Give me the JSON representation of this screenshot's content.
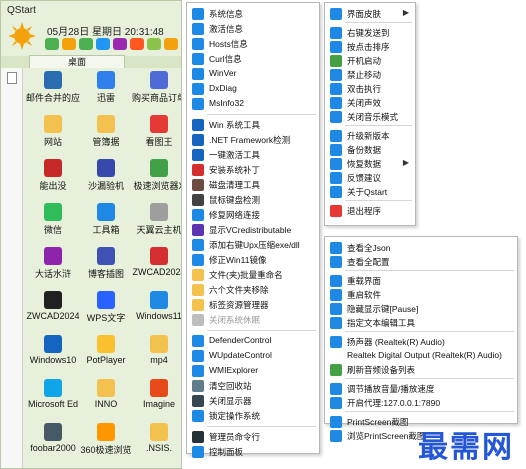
{
  "app": {
    "title": "QStart",
    "date_text": "05月28日 星期日 20:31:48",
    "desktop_tab": "桌面"
  },
  "colors": {
    "window_bg": "#e6f0da",
    "tab_bg": "#d8e6c6",
    "sun": "#f4a20c"
  },
  "week_icon_colors": [
    "#4caf50",
    "#f4a20c",
    "#4caf50",
    "#2196f3",
    "#9c27b0",
    "#ff5722",
    "#8bc34a",
    "#f4a20c"
  ],
  "desktop_items": [
    {
      "label": "邮件合并的应",
      "icon": "mail-merge-icon",
      "color": "#2b6cb0"
    },
    {
      "label": "迅雷",
      "icon": "thunder-icon",
      "color": "#2f80ed"
    },
    {
      "label": "购买商品订单",
      "icon": "order-doc-icon",
      "color": "#4f6bd6"
    },
    {
      "label": "网站",
      "icon": "folder-icon",
      "color": "#f2c14e"
    },
    {
      "label": "管簿据",
      "icon": "folder-icon",
      "color": "#f2c14e"
    },
    {
      "label": "看图王",
      "icon": "image-viewer-icon",
      "color": "#e53935"
    },
    {
      "label": "能出没",
      "icon": "file-icon",
      "color": "#c62828"
    },
    {
      "label": "沙漏验机",
      "icon": "hourglass-icon",
      "color": "#3949ab"
    },
    {
      "label": "极速浏览器X",
      "icon": "browser-icon",
      "color": "#43a047"
    },
    {
      "label": "微信",
      "icon": "wechat-icon",
      "color": "#2ebd59"
    },
    {
      "label": "工具箱",
      "icon": "toolbox-icon",
      "color": "#1e88e5"
    },
    {
      "label": "天翼云主机",
      "icon": "doc-icon",
      "color": "#9e9e9e"
    },
    {
      "label": "大话水浒",
      "icon": "game-icon",
      "color": "#8e24aa"
    },
    {
      "label": "博客插图",
      "icon": "picture-icon",
      "color": "#3f51b5"
    },
    {
      "label": "ZWCAD2024",
      "icon": "cad-icon",
      "color": "#d32f2f"
    },
    {
      "label": "ZWCAD2024",
      "icon": "cad-dark-icon",
      "color": "#212121"
    },
    {
      "label": "WPS文字",
      "icon": "wps-writer-icon",
      "color": "#2962ff"
    },
    {
      "label": "Windows11",
      "icon": "windows11-icon",
      "color": "#1e88e5"
    },
    {
      "label": "Windows10",
      "icon": "windows10-icon",
      "color": "#1565c0"
    },
    {
      "label": "PotPlayer",
      "icon": "potplayer-icon",
      "color": "#fbc02d"
    },
    {
      "label": "mp4",
      "icon": "folder-icon",
      "color": "#f2c14e"
    },
    {
      "label": "Microsoft Ed",
      "icon": "edge-icon",
      "color": "#0ea5e9"
    },
    {
      "label": "INNO",
      "icon": "folder-icon",
      "color": "#f2c14e"
    },
    {
      "label": "Imagine",
      "icon": "imagine-icon",
      "color": "#e64a19"
    },
    {
      "label": "foobar2000",
      "icon": "foobar-icon",
      "color": "#455a64"
    },
    {
      "label": "360极速浏览",
      "icon": "360-browser-icon",
      "color": "#ff9800"
    },
    {
      "label": ".NSIS.",
      "icon": "folder-icon",
      "color": "#f2c14e"
    }
  ],
  "menu_left": {
    "items": [
      {
        "label": "系统信息",
        "icon": "system-info-icon",
        "color": "#1e88e5"
      },
      {
        "label": "激活信息",
        "icon": "activation-icon",
        "color": "#1e88e5"
      },
      {
        "label": "Hosts信息",
        "icon": "hosts-icon",
        "color": "#1e88e5"
      },
      {
        "label": "Curl信息",
        "icon": "curl-icon",
        "color": "#1e88e5"
      },
      {
        "label": "WinVer",
        "icon": "winver-icon",
        "color": "#1e88e5"
      },
      {
        "label": "DxDiag",
        "icon": "dxdiag-icon",
        "color": "#1e88e5"
      },
      {
        "label": "MsInfo32",
        "icon": "msinfo-icon",
        "color": "#1e88e5"
      },
      {
        "sep": true
      },
      {
        "label": "Win 系统工具",
        "icon": "win-tools-icon",
        "color": "#1565c0"
      },
      {
        "label": ".NET Framework检测",
        "icon": "dotnet-icon",
        "color": "#1565c0"
      },
      {
        "label": "一键激活工具",
        "icon": "activate-tool-icon",
        "color": "#1565c0"
      },
      {
        "label": "安装系统补丁",
        "icon": "patch-icon",
        "color": "#d32f2f"
      },
      {
        "label": "磁盘清理工具",
        "icon": "disk-clean-icon",
        "color": "#6d4c41"
      },
      {
        "label": "鼠标键盘检测",
        "icon": "mouse-keyboard-icon",
        "color": "#424242"
      },
      {
        "label": "修复网络连接",
        "icon": "network-repair-icon",
        "color": "#1e88e5"
      },
      {
        "label": "显示VCredistributable",
        "icon": "vc-icon",
        "color": "#5e35b1"
      },
      {
        "label": "添加右键Upx压缩exe/dll",
        "icon": "upx-icon",
        "color": "#1e88e5"
      },
      {
        "label": "修正Win11镜像",
        "icon": "win11-fix-icon",
        "color": "#1e88e5"
      },
      {
        "label": "文件(夹)批量重命名",
        "icon": "rename-icon",
        "color": "#f2c14e"
      },
      {
        "label": "六个文件夹移除",
        "icon": "folder-remove-icon",
        "color": "#f2c14e"
      },
      {
        "label": "标签资源管理器",
        "icon": "tab-explorer-icon",
        "color": "#f2c14e"
      },
      {
        "label": "关闭系统休眠",
        "icon": "hibernate-icon",
        "color": "#bdbdbd",
        "disabled": true
      },
      {
        "sep": true
      },
      {
        "label": "DefenderControl",
        "icon": "defender-icon",
        "color": "#1e88e5"
      },
      {
        "label": "WUpdateControl",
        "icon": "wupdate-icon",
        "color": "#1e88e5"
      },
      {
        "label": "WMIExplorer",
        "icon": "wmi-icon",
        "color": "#1e88e5"
      },
      {
        "label": "清空回收站",
        "icon": "recycle-bin-icon",
        "color": "#607d8b"
      },
      {
        "label": "关闭显示器",
        "icon": "monitor-off-icon",
        "color": "#37474f"
      },
      {
        "label": "锁定操作系统",
        "icon": "lock-icon",
        "color": "#1e88e5"
      },
      {
        "sep": true
      },
      {
        "label": "管理员命令行",
        "icon": "cmd-admin-icon",
        "color": "#263238"
      },
      {
        "label": "控制面板",
        "icon": "control-panel-icon",
        "color": "#1e88e5"
      }
    ]
  },
  "menu_right_top": {
    "items": [
      {
        "label": "界面皮肤",
        "icon": "skin-icon",
        "color": "#1e88e5",
        "submenu": true
      },
      {
        "sep": true
      },
      {
        "label": "右键发送到",
        "icon": "send-to-icon",
        "color": "#1e88e5"
      },
      {
        "label": "按点击排序",
        "icon": "sort-icon",
        "color": "#1e88e5"
      },
      {
        "label": "开机启动",
        "icon": "startup-icon",
        "color": "#43a047"
      },
      {
        "label": "禁止移动",
        "icon": "no-move-icon",
        "color": "#1e88e5"
      },
      {
        "label": "双击执行",
        "icon": "double-click-icon",
        "color": "#1e88e5"
      },
      {
        "label": "关闭声效",
        "icon": "sound-off-icon",
        "color": "#1e88e5"
      },
      {
        "label": "关闭音乐模式",
        "icon": "music-off-icon",
        "color": "#1e88e5"
      },
      {
        "sep": true
      },
      {
        "label": "升级新版本",
        "icon": "upgrade-icon",
        "color": "#1e88e5"
      },
      {
        "label": "备份数据",
        "icon": "backup-icon",
        "color": "#1e88e5"
      },
      {
        "label": "恢复数据",
        "icon": "restore-icon",
        "color": "#1e88e5",
        "submenu": true
      },
      {
        "label": "反馈建议",
        "icon": "feedback-icon",
        "color": "#1e88e5"
      },
      {
        "label": "关于Qstart",
        "icon": "about-icon",
        "color": "#1e88e5"
      },
      {
        "sep": true
      },
      {
        "label": "退出程序",
        "icon": "exit-icon",
        "color": "#e53935"
      }
    ]
  },
  "menu_right_bottom": {
    "items": [
      {
        "label": "查看全Json",
        "icon": "json-icon",
        "color": "#1e88e5"
      },
      {
        "label": "查看全配置",
        "icon": "config-icon",
        "color": "#1e88e5"
      },
      {
        "sep": true
      },
      {
        "label": "重载界面",
        "icon": "reload-ui-icon",
        "color": "#1e88e5"
      },
      {
        "label": "重启软件",
        "icon": "restart-icon",
        "color": "#1e88e5"
      },
      {
        "label": "隐藏显示键[Pause]",
        "icon": "hide-key-icon",
        "color": "#1e88e5"
      },
      {
        "label": "指定文本编辑工具",
        "icon": "text-editor-icon",
        "color": "#1e88e5"
      },
      {
        "sep": true
      },
      {
        "label": "扬声器 (Realtek(R) Audio)",
        "icon": "speaker-icon",
        "color": "#1e88e5"
      },
      {
        "label": "Realtek Digital Output (Realtek(R) Audio)",
        "icon": "",
        "color": ""
      },
      {
        "label": "刷新音频设备列表",
        "icon": "refresh-audio-icon",
        "color": "#43a047"
      },
      {
        "sep": true
      },
      {
        "label": "调节播放音量/播放速度",
        "icon": "volume-icon",
        "color": "#1e88e5"
      },
      {
        "label": "开启代理:127.0.0.1:7890",
        "icon": "proxy-icon",
        "color": "#1e88e5"
      },
      {
        "sep": true
      },
      {
        "label": "PrintScreen截图",
        "icon": "screenshot-icon",
        "color": "#1e88e5"
      },
      {
        "label": "浏览PrintScreen截图",
        "icon": "browse-screenshot-icon",
        "color": "#1e88e5"
      }
    ]
  },
  "watermark": {
    "text": "最需网"
  }
}
